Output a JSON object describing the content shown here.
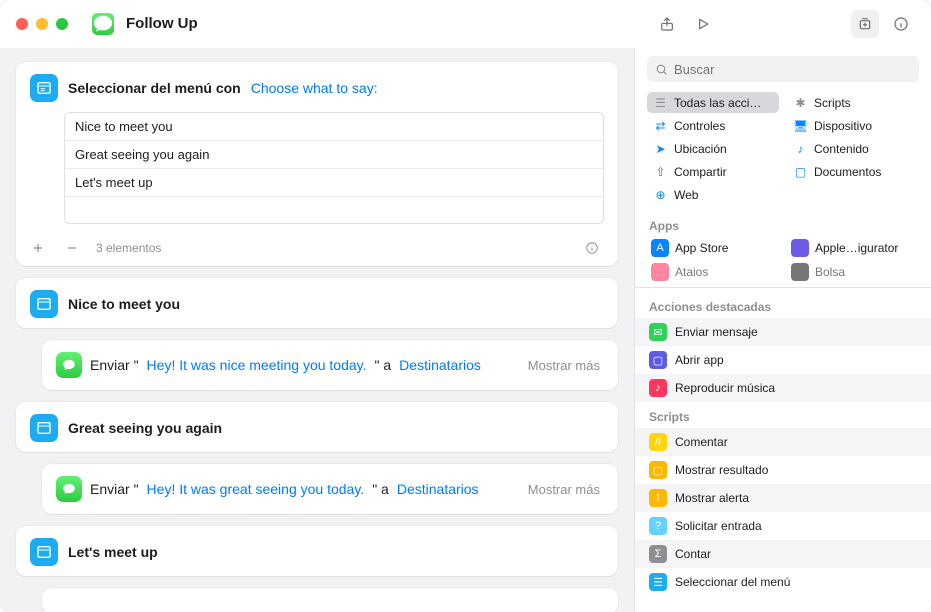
{
  "window": {
    "title": "Follow Up"
  },
  "menuCard": {
    "title": "Seleccionar del menú con",
    "prompt": "Choose what to say:",
    "items": [
      "Nice to meet you",
      "Great seeing you again",
      "Let's meet up"
    ],
    "count": "3 elementos"
  },
  "sections": [
    {
      "title": "Nice to meet you",
      "prefix": "Enviar \"",
      "body": "Hey! It was nice meeting you today.",
      "mid": "\" a",
      "recipients": "Destinatarios",
      "more": "Mostrar más"
    },
    {
      "title": "Great seeing you again",
      "prefix": "Enviar \"",
      "body": "Hey! It was great seeing you today.",
      "mid": "\" a",
      "recipients": "Destinatarios",
      "more": "Mostrar más"
    },
    {
      "title": "Let's meet up",
      "prefix": "",
      "body": "",
      "mid": "",
      "recipients": "",
      "more": ""
    }
  ],
  "sidebar": {
    "search_placeholder": "Buscar",
    "categories": [
      {
        "label": "Todas las acci…",
        "color": "#8e8e93",
        "selected": true
      },
      {
        "label": "Scripts",
        "color": "#8e8e93"
      },
      {
        "label": "Controles",
        "color": "#0a84ff"
      },
      {
        "label": "Dispositivo",
        "color": "#0a84ff"
      },
      {
        "label": "Ubicación",
        "color": "#0a84ff"
      },
      {
        "label": "Contenido",
        "color": "#0a84ff"
      },
      {
        "label": "Compartir",
        "color": "#0a84ff"
      },
      {
        "label": "Documentos",
        "color": "#0a84ff"
      },
      {
        "label": "Web",
        "color": "#0a84ff"
      }
    ],
    "apps_header": "Apps",
    "apps": [
      {
        "label": "App Store",
        "bg": "#0a84ff"
      },
      {
        "label": "Apple…igurator",
        "bg": "#6e5ce6"
      },
      {
        "label": "Ataios",
        "bg": "#ff375f"
      },
      {
        "label": "Bolsa",
        "bg": "#1d1d1f"
      }
    ],
    "featured_header": "Acciones destacadas",
    "featured": [
      {
        "label": "Enviar mensaje",
        "bg": "#30d158"
      },
      {
        "label": "Abrir app",
        "bg": "#5e5ce6"
      },
      {
        "label": "Reproducir música",
        "bg": "#ff375f"
      }
    ],
    "scripts_header": "Scripts",
    "scripts": [
      {
        "label": "Comentar",
        "bg": "#ffd60a"
      },
      {
        "label": "Mostrar resultado",
        "bg": "#ffb800"
      },
      {
        "label": "Mostrar alerta",
        "bg": "#ffb800"
      },
      {
        "label": "Solicitar entrada",
        "bg": "#64d2ff"
      },
      {
        "label": "Contar",
        "bg": "#8e8e93"
      },
      {
        "label": "Seleccionar del menú",
        "bg": "#1dabf2"
      }
    ]
  }
}
